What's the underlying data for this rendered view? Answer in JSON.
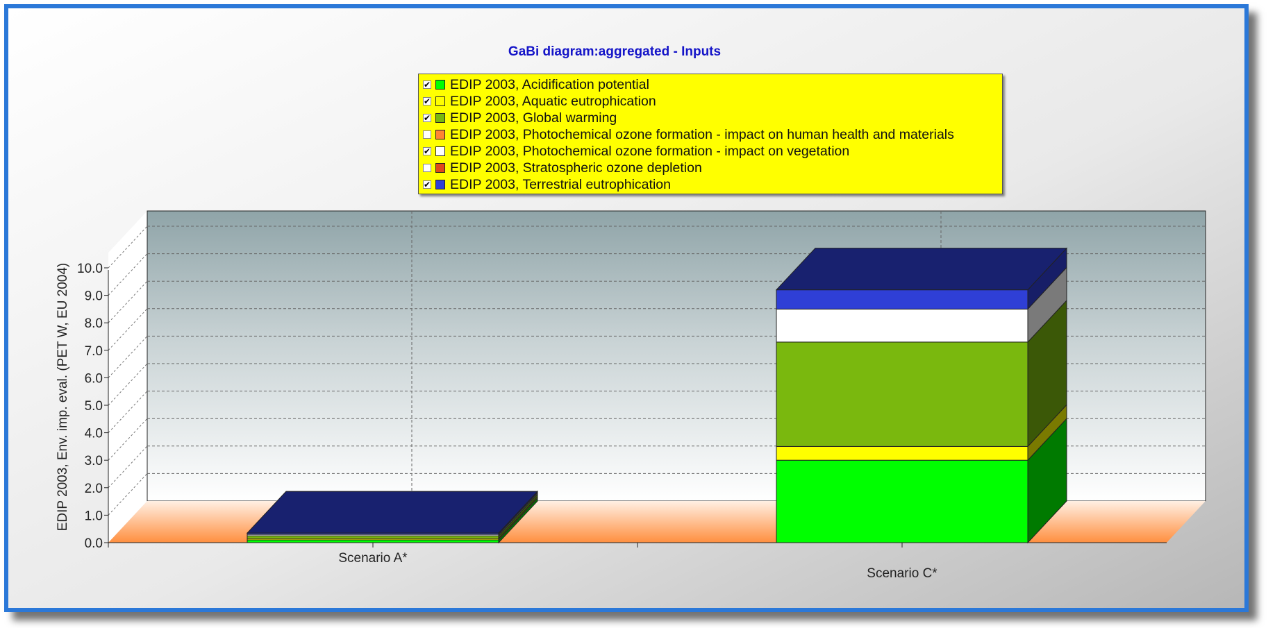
{
  "chart_data": {
    "type": "bar",
    "subtype": "stacked-3d",
    "title": "GaBi diagram:aggregated - Inputs",
    "xlabel": "",
    "ylabel": "EDIP 2003, Env. imp. eval. (PET W, EU 2004)",
    "ylim": [
      0,
      10
    ],
    "yticks": [
      "0.0",
      "1.0",
      "2.0",
      "3.0",
      "4.0",
      "5.0",
      "6.0",
      "7.0",
      "8.0",
      "9.0",
      "10.0"
    ],
    "grid": true,
    "legend_position": "top",
    "categories": [
      "Scenario A*",
      "Scenario C*"
    ],
    "series": [
      {
        "name": "EDIP 2003, Acidification potential",
        "checked": true,
        "color": "#00ff00",
        "values": [
          0.1,
          3.0
        ]
      },
      {
        "name": "EDIP 2003, Aquatic eutrophication",
        "checked": true,
        "color": "#ffff00",
        "values": [
          0.05,
          0.5
        ]
      },
      {
        "name": "EDIP 2003, Global warming",
        "checked": true,
        "color": "#7ab80e",
        "values": [
          0.1,
          3.8
        ]
      },
      {
        "name": "EDIP 2003, Photochemical ozone formation - impact on human health and materials",
        "checked": false,
        "color": "#ff8533",
        "values": [
          0,
          0
        ]
      },
      {
        "name": "EDIP 2003, Photochemical ozone formation - impact on vegetation",
        "checked": true,
        "color": "#ffffff",
        "values": [
          0.05,
          1.2
        ]
      },
      {
        "name": "EDIP 2003, Stratospheric ozone depletion",
        "checked": false,
        "color": "#e04a1a",
        "values": [
          0,
          0
        ]
      },
      {
        "name": "EDIP 2003, Terrestrial eutrophication",
        "checked": true,
        "color": "#2f3fd6",
        "values": [
          0.05,
          0.7
        ]
      }
    ]
  }
}
